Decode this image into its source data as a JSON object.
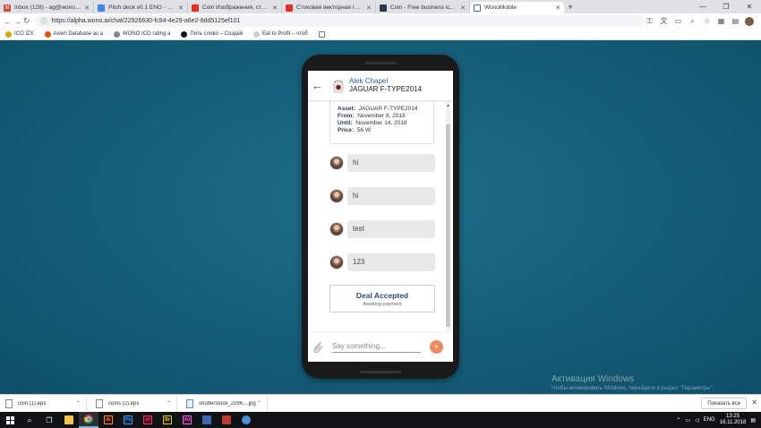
{
  "browser": {
    "tabs": [
      {
        "title": "Inbox (128) - ag@wono.io - wor",
        "favicon": "gmail-icon",
        "color": "#d44638",
        "active": false
      },
      {
        "title": "Pitch deck v0.1 ENG - Google Dr",
        "favicon": "google-slides-icon",
        "color": "#4285f4",
        "active": false
      },
      {
        "title": "Coin Изображения, стоковые ф",
        "favicon": "shutterstock-icon",
        "color": "#ee2b24",
        "active": false
      },
      {
        "title": "Стоковая векторная графика «",
        "favicon": "shutterstock-icon",
        "color": "#ee2b24",
        "active": false
      },
      {
        "title": "Coin - Free business icons",
        "favicon": "flaticon-icon",
        "color": "#2b3a4a",
        "active": false
      },
      {
        "title": "WonoMobile",
        "favicon": "wono-icon",
        "color": "#3a6ea5",
        "active": true
      }
    ],
    "new_tab": "+",
    "url": "https://alpha.wono.ai/chat/22926630-fc84-4e29-a6e2-8dd5125ef101",
    "bookmarks": [
      {
        "label": "ICO IZX",
        "color": "#e0a800"
      },
      {
        "label": "Aiven Database as a",
        "color": "#e84e0e"
      },
      {
        "label": "WONO ICO rating a",
        "color": "#888888"
      },
      {
        "label": "Пить слово – Создай",
        "color": "#111111"
      },
      {
        "label": "Eat to Profit – чтоб",
        "color": "#cccccc"
      },
      {
        "label": "",
        "color": "#ffffff"
      }
    ]
  },
  "chat": {
    "header": {
      "name": "Alek Chapel",
      "subtitle": "JAGUAR F-TYPE2014",
      "back_glyph": "←"
    },
    "deal": {
      "asset_label": "Asset:",
      "asset_value": "JAGUAR F-TYPE2014",
      "from_label": "From:",
      "from_value": "November 8, 2018",
      "until_label": "Until:",
      "until_value": "November 14, 2018",
      "price_label": "Price:",
      "price_value": "56 W"
    },
    "messages": [
      {
        "text": "hi"
      },
      {
        "text": "hi"
      },
      {
        "text": "test"
      },
      {
        "text": "123"
      }
    ],
    "status": {
      "title": "Deal Accepted",
      "subtitle": "Awaiting payment"
    },
    "composer": {
      "placeholder": "Say something...",
      "send_glyph": "➤"
    }
  },
  "watermark": {
    "title": "Активация Windows",
    "subtitle": "Чтобы активировать Windows, перейдите в раздел \"Параметры\"."
  },
  "downloads": {
    "files": [
      {
        "name": "coin (1).eps"
      },
      {
        "name": "coins (2).eps"
      },
      {
        "name": "shutterstock_2296....jpg"
      }
    ],
    "show_all": "Показать все"
  },
  "taskbar": {
    "lang": "ENG",
    "time": "13:25",
    "date": "16.11.2018",
    "apps": [
      {
        "name": "start",
        "color": "#101316",
        "glyph": ""
      },
      {
        "name": "search",
        "color": "#101316",
        "glyph": ""
      },
      {
        "name": "task-view",
        "color": "#101316",
        "glyph": ""
      },
      {
        "name": "file-explorer",
        "color": "#f4c542",
        "glyph": ""
      },
      {
        "name": "chrome",
        "color": "#4caf50",
        "glyph": ""
      },
      {
        "name": "illustrator",
        "color": "#330000",
        "glyph": "Ai"
      },
      {
        "name": "photoshop",
        "color": "#001d34",
        "glyph": "Ps"
      },
      {
        "name": "indesign",
        "color": "#49021f",
        "glyph": "Id"
      },
      {
        "name": "bridge",
        "color": "#1e1c00",
        "glyph": "Br"
      },
      {
        "name": "xd",
        "color": "#2e001f",
        "glyph": "Xd"
      },
      {
        "name": "app-blue",
        "color": "#3c64b4",
        "glyph": ""
      },
      {
        "name": "app-red",
        "color": "#c0392b",
        "glyph": ""
      },
      {
        "name": "app-chrome-2",
        "color": "#4a90d9",
        "glyph": ""
      }
    ]
  }
}
